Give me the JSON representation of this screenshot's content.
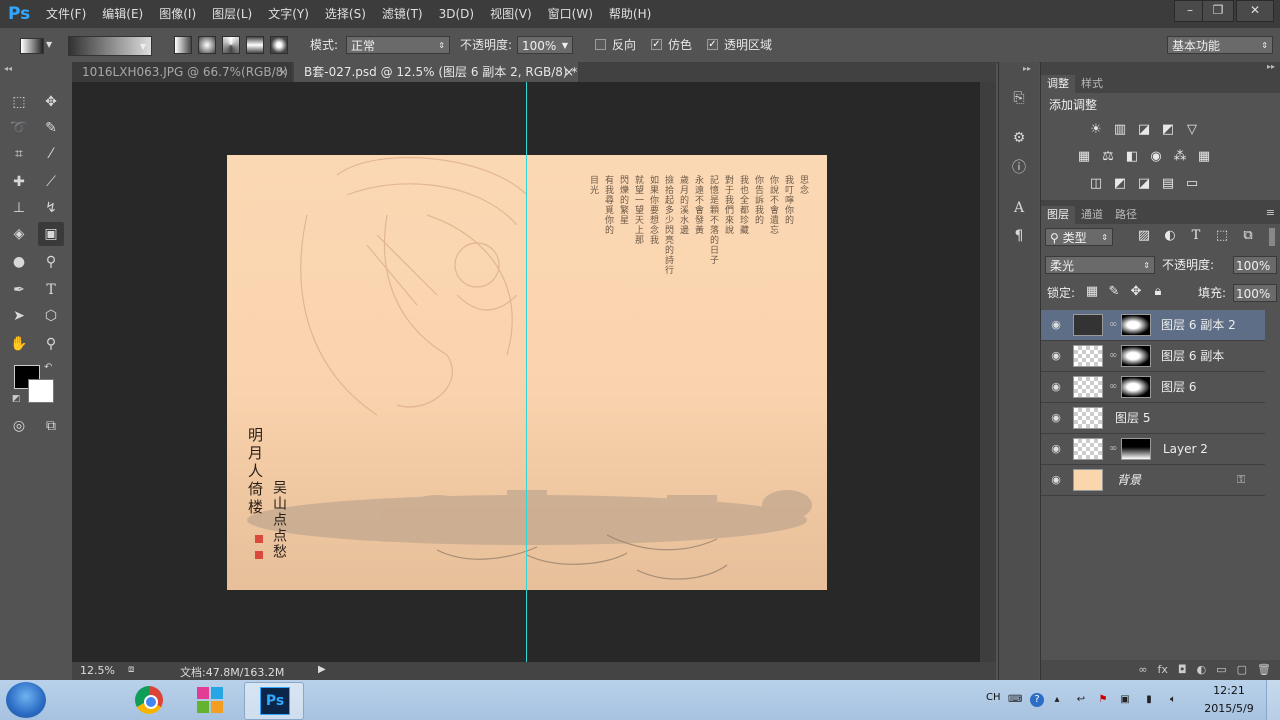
{
  "app": {
    "logo": "Ps"
  },
  "menu": [
    "文件(F)",
    "编辑(E)",
    "图像(I)",
    "图层(L)",
    "文字(Y)",
    "选择(S)",
    "滤镜(T)",
    "3D(D)",
    "视图(V)",
    "窗口(W)",
    "帮助(H)"
  ],
  "window_controls": {
    "minimize": "–",
    "restore": "❐",
    "close": "✕"
  },
  "options": {
    "mode_label": "模式:",
    "mode_value": "正常",
    "opacity_label": "不透明度:",
    "opacity_value": "100%",
    "reverse_label": "反向",
    "dither_label": "仿色",
    "transparency_label": "透明区域",
    "workspace": "基本功能"
  },
  "tabs": [
    {
      "label": "1016LXH063.JPG @ 66.7%(RGB/8)",
      "close": "×"
    },
    {
      "label": "B套-027.psd @ 12.5% (图层 6 副本 2, RGB/8) *",
      "close": "×"
    }
  ],
  "document": {
    "poem_columns": [
      "思念",
      "我叮嚀你的",
      "你說不會遺忘",
      "你告訴我的",
      "我也全都珍藏",
      "對于我們來說",
      "記憶是顆不落的日子",
      "永遠不會發黃",
      "歲月的溪水邊",
      "撿拾起多少閃亮的詩行",
      "如果你要想念我",
      "就望一望天上那",
      "閃爍的繁星",
      "有我尋覓你的",
      "目光"
    ],
    "title": "明月人倚楼",
    "signature": "吴山点点愁"
  },
  "status": {
    "zoom": "12.5%",
    "doc_info": "文档:47.8M/163.2M"
  },
  "panels": {
    "adjustments_tab": "调整",
    "styles_tab": "样式",
    "add_adjustment": "添加调整",
    "layers_tab": "图层",
    "channels_tab": "通道",
    "paths_tab": "路径",
    "filter_kind": "类型",
    "blend_mode": "柔光",
    "opacity_label": "不透明度:",
    "opacity_value": "100%",
    "lock_label": "锁定:",
    "fill_label": "填充:",
    "fill_value": "100%"
  },
  "layers": [
    {
      "name": "图层 6 副本 2",
      "selected": true,
      "mask": true
    },
    {
      "name": "图层 6 副本",
      "selected": false,
      "mask": true
    },
    {
      "name": "图层 6",
      "selected": false,
      "mask": true
    },
    {
      "name": "图层 5",
      "selected": false,
      "mask": false
    },
    {
      "name": "Layer 2",
      "selected": false,
      "mask": true
    },
    {
      "name": "背景",
      "selected": false,
      "mask": false,
      "locked": true
    }
  ],
  "taskbar": {
    "lang": "CH",
    "time": "12:21",
    "date": "2015/5/9",
    "apps": [
      "chrome",
      "metro-app",
      "photoshop"
    ],
    "ps_label": "Ps"
  },
  "colors": {
    "accent": "#31a8ff",
    "guide": "#33d6d6",
    "selected_layer": "#5d6e86"
  }
}
